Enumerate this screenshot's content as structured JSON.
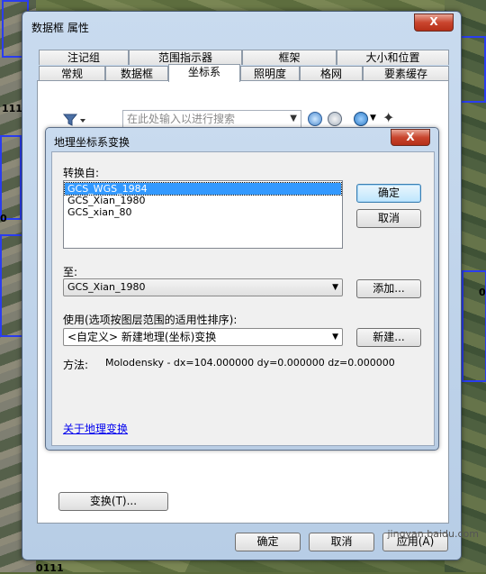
{
  "window": {
    "title": "数据框 属性",
    "close_label": "X"
  },
  "tabs_top": [
    "注记组",
    "范围指示器",
    "框架",
    "大小和位置"
  ],
  "tabs_bottom": [
    "常规",
    "数据框",
    "坐标系",
    "照明度",
    "格网",
    "要素缓存"
  ],
  "toolbar": {
    "filter_icon": "filter-icon",
    "search_placeholder": "在此处输入以进行搜索",
    "search_icon": "search-icon",
    "clear_search_icon": "clear-search-icon",
    "globe_icon": "globe-icon",
    "favorite_icon": "add-favorite-icon"
  },
  "dialog": {
    "title": "地理坐标系变换",
    "close_label": "X",
    "convert_from_label": "转换自:",
    "convert_from_items": [
      "GCS_WGS_1984",
      "GCS_Xian_1980",
      "GCS_xian_80"
    ],
    "ok_label": "确定",
    "cancel_label": "取消",
    "to_label": "至:",
    "to_value": "GCS_Xian_1980",
    "add_label": "添加...",
    "using_label": "使用(选项按图层范围的适用性排序):",
    "using_value": "<自定义> 新建地理(坐标)变换",
    "new_label": "新建...",
    "method_label": "方法:",
    "method_value": "Molodensky - dx=104.000000 dy=0.000000 dz=0.000000",
    "about_link": "关于地理变换"
  },
  "transform_button": "变换(T)...",
  "footer": {
    "ok": "确定",
    "cancel": "取消",
    "apply": "应用(A)"
  },
  "map_labels": [
    "111 0",
    "0",
    "0",
    "0111"
  ],
  "watermark": "jingyan.baidu.com"
}
